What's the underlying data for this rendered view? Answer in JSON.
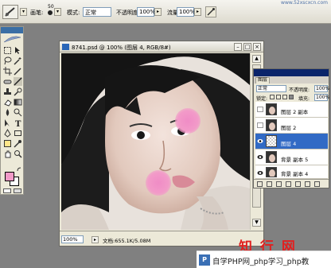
{
  "options_bar": {
    "brush_label": "画笔:",
    "brush_size": "50",
    "mode_label": "模式:",
    "mode_value": "正常",
    "opacity_label": "不透明度:",
    "opacity_value": "100%",
    "flow_label": "流量:",
    "flow_value": "100%",
    "site_text": "www.52xscxcn.com"
  },
  "document": {
    "title": "8741.psd @ 100% (图层 4, RGB/8#)",
    "zoom": "100%",
    "doc_info": "文档:655.1K/5.08M"
  },
  "toolbox": {
    "foreground_color": "#f29ac8",
    "background_color": "#ffffff"
  },
  "layers_panel": {
    "tab_label": "图层",
    "blend_mode": "正常",
    "opacity_label": "不透明度:",
    "opacity_value": "100%",
    "lock_label": "锁定:",
    "fill_label": "填充:",
    "fill_value": "100%",
    "layers": [
      {
        "name": "图层 2 副本",
        "visible": false,
        "active": false
      },
      {
        "name": "图层 2",
        "visible": false,
        "active": false
      },
      {
        "name": "图层 4",
        "visible": true,
        "active": true
      },
      {
        "name": "背景 副本 5",
        "visible": true,
        "active": false
      },
      {
        "name": "背景 副本 4",
        "visible": true,
        "active": false
      }
    ]
  },
  "branding": {
    "logo_text": "知 行 网",
    "footer_text": "自学PHP网_php学习_php教"
  }
}
